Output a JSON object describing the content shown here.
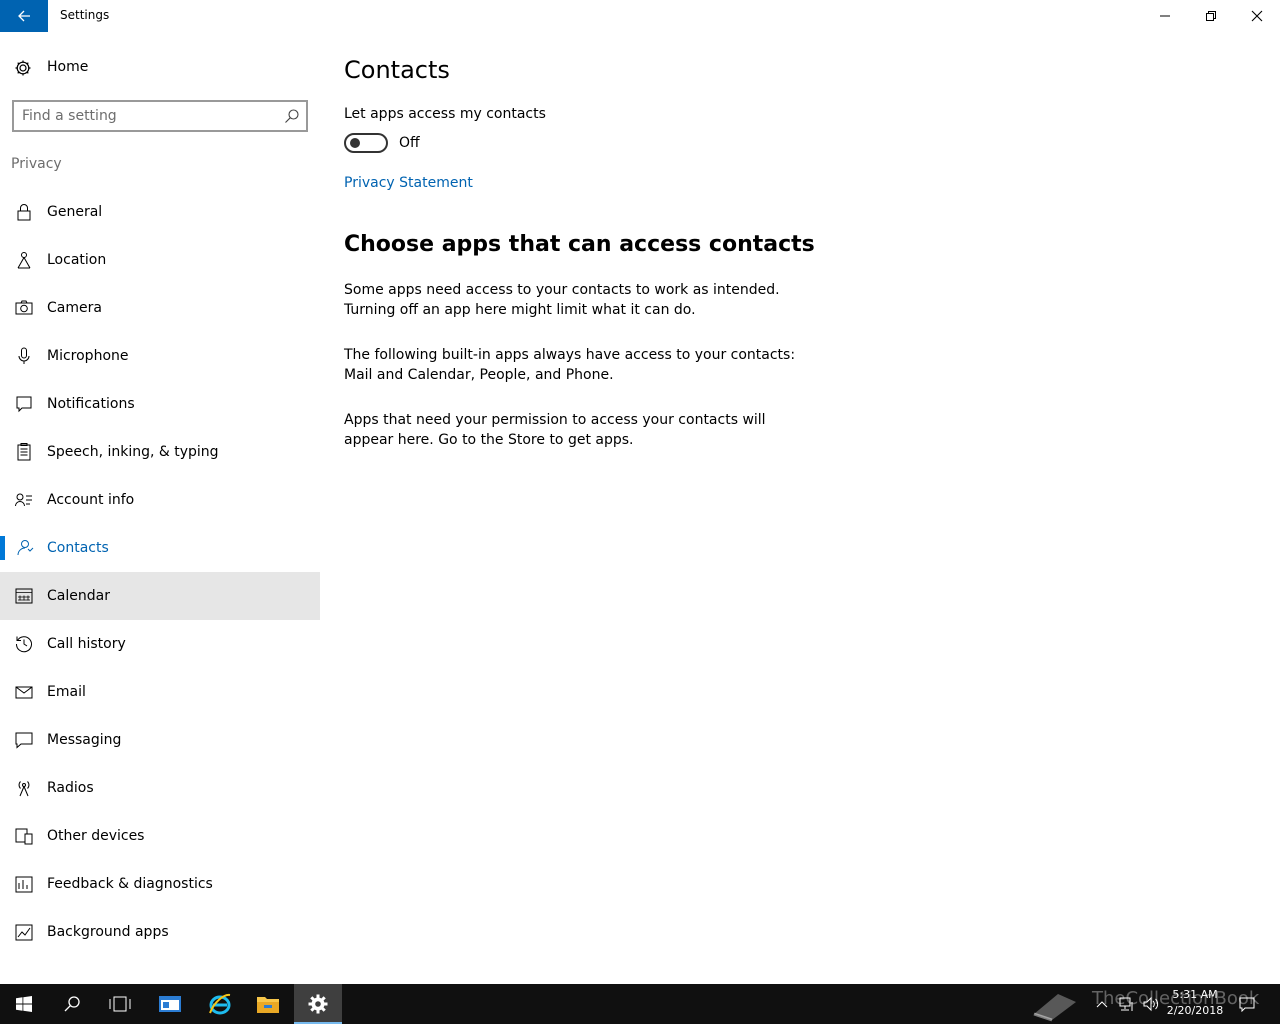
{
  "window": {
    "title": "Settings"
  },
  "sidebar": {
    "home_label": "Home",
    "search_placeholder": "Find a setting",
    "section_label": "Privacy",
    "items": [
      {
        "label": "General",
        "icon": "lock-icon"
      },
      {
        "label": "Location",
        "icon": "location-icon"
      },
      {
        "label": "Camera",
        "icon": "camera-icon"
      },
      {
        "label": "Microphone",
        "icon": "microphone-icon"
      },
      {
        "label": "Notifications",
        "icon": "notifications-icon"
      },
      {
        "label": "Speech, inking, & typing",
        "icon": "speech-icon"
      },
      {
        "label": "Account info",
        "icon": "account-info-icon"
      },
      {
        "label": "Contacts",
        "icon": "contacts-icon",
        "selected": true
      },
      {
        "label": "Calendar",
        "icon": "calendar-icon",
        "hovered": true
      },
      {
        "label": "Call history",
        "icon": "call-history-icon"
      },
      {
        "label": "Email",
        "icon": "email-icon"
      },
      {
        "label": "Messaging",
        "icon": "messaging-icon"
      },
      {
        "label": "Radios",
        "icon": "radios-icon"
      },
      {
        "label": "Other devices",
        "icon": "other-devices-icon"
      },
      {
        "label": "Feedback & diagnostics",
        "icon": "feedback-icon"
      },
      {
        "label": "Background apps",
        "icon": "background-apps-icon"
      }
    ]
  },
  "main": {
    "title": "Contacts",
    "setting_label": "Let apps access my contacts",
    "toggle_state": "Off",
    "toggle_on": false,
    "privacy_link": "Privacy Statement",
    "section_heading": "Choose apps that can access contacts",
    "paragraphs": [
      "Some apps need access to your contacts to work as intended. Turning off an app here might limit what it can do.",
      "The following built-in apps always have access to your contacts: Mail and Calendar, People, and Phone.",
      "Apps that need your permission to access your contacts will appear here. Go to the Store to get apps."
    ]
  },
  "taskbar": {
    "time": "5:31 AM",
    "date": "2/20/2018",
    "watermark": "TheCollectionBook"
  },
  "colors": {
    "accent": "#0078d7",
    "link": "#0063b1",
    "back_button": "#0063b1",
    "taskbar": "#101010",
    "hover": "#e6e6e6"
  }
}
